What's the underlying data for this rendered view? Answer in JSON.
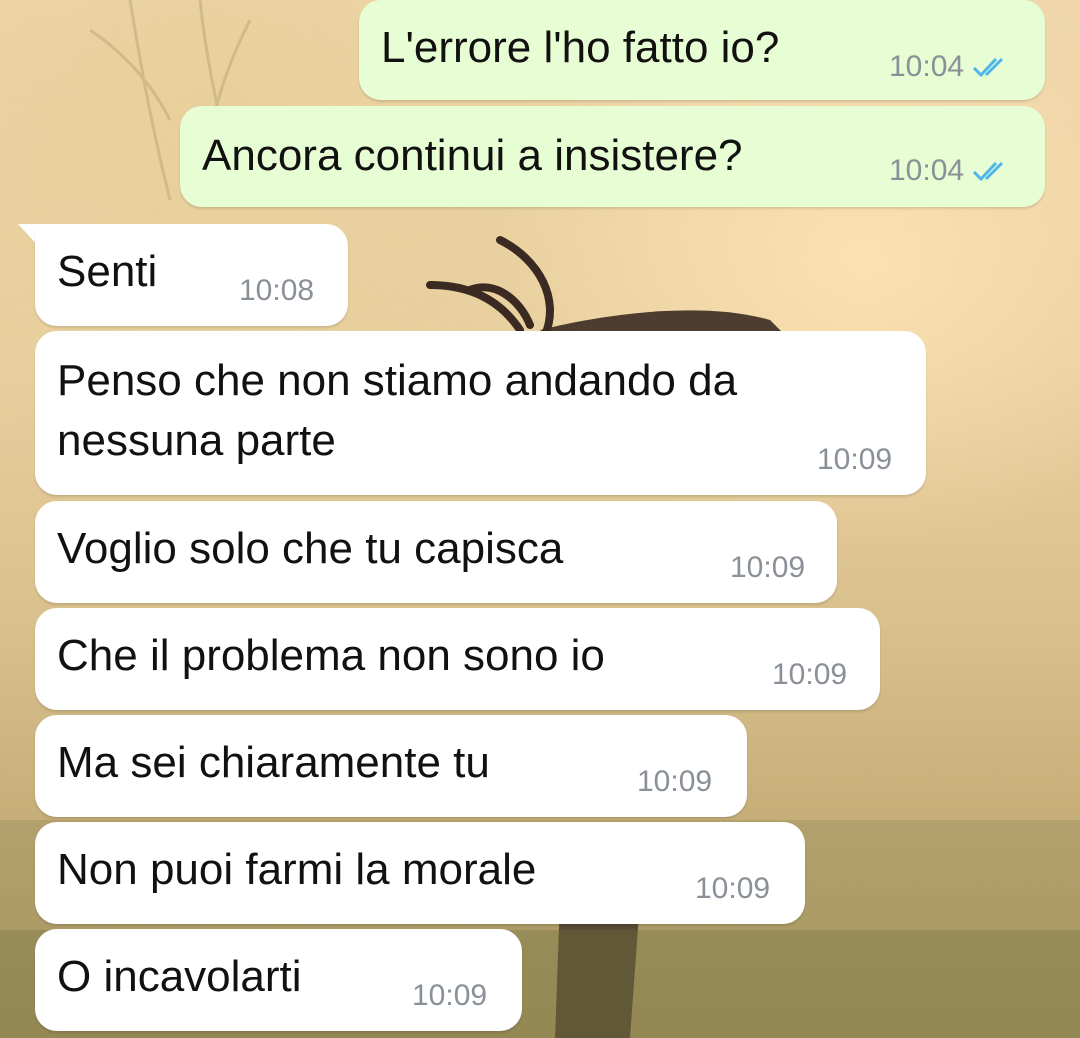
{
  "messages": [
    {
      "direction": "outgoing",
      "text": "L'errore l'ho fatto io?",
      "time": "10:04",
      "status": "read-double-check-icon"
    },
    {
      "direction": "outgoing",
      "text": "Ancora continui a insistere?",
      "time": "10:04",
      "status": "read-double-check-icon"
    },
    {
      "direction": "incoming",
      "text": "Senti",
      "time": "10:08"
    },
    {
      "direction": "incoming",
      "text": "Penso che non stiamo andando da nessuna parte",
      "time": "10:09"
    },
    {
      "direction": "incoming",
      "text": "Voglio solo che tu capisca",
      "time": "10:09"
    },
    {
      "direction": "incoming",
      "text": "Che il problema non sono io",
      "time": "10:09"
    },
    {
      "direction": "incoming",
      "text": "Ma sei chiaramente tu",
      "time": "10:09"
    },
    {
      "direction": "incoming",
      "text": "Non puoi farmi la morale",
      "time": "10:09"
    },
    {
      "direction": "incoming",
      "text": "O incavolarti",
      "time": "10:09"
    }
  ],
  "colors": {
    "outgoing_bubble": "#e7fdd3",
    "incoming_bubble": "#ffffff",
    "read_ticks": "#4fb6ec",
    "timestamp": "#8a9097"
  }
}
